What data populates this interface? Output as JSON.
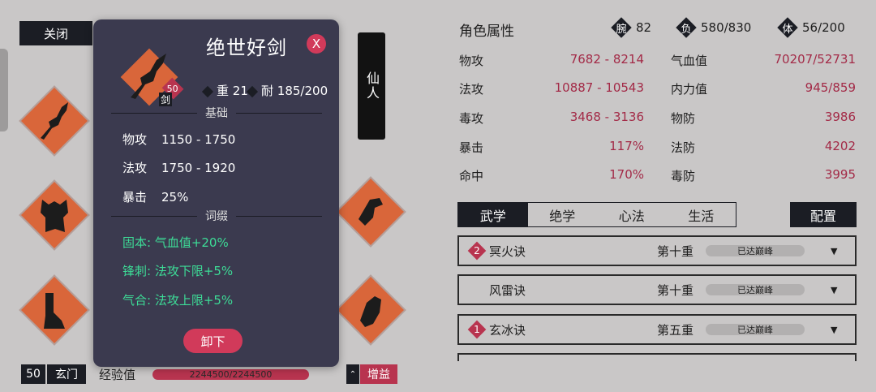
{
  "equipment": {
    "close_label": "关闭",
    "immortal_label": "仙人",
    "slots": [
      {
        "icon": "sword-icon"
      },
      {
        "icon": "armor-icon"
      },
      {
        "icon": "boots-icon"
      },
      {
        "icon": "bracer-icon"
      },
      {
        "icon": "amulet-icon"
      }
    ]
  },
  "bottom_bar": {
    "level": "50",
    "sect": "玄门",
    "exp_label": "经验值",
    "exp_value": "2244500/2244500",
    "exp_fraction": 1.0,
    "buff_label": "增益"
  },
  "popup": {
    "name": "绝世好剑",
    "close_label": "X",
    "level": "50",
    "type": "剑",
    "weight_label": "重",
    "weight": "21",
    "durability_label": "耐",
    "durability": "185/200",
    "base_header": "基础",
    "base_stats": [
      {
        "label": "物攻",
        "value": "1150 - 1750"
      },
      {
        "label": "法攻",
        "value": "1750 - 1920"
      },
      {
        "label": "暴击",
        "value": "25%"
      }
    ],
    "affix_header": "词缀",
    "affixes": [
      {
        "text": "固本: 气血值+20%"
      },
      {
        "text": "锋刺: 法攻下限+5%"
      },
      {
        "text": "气合: 法攻上限+5%"
      }
    ],
    "unequip_label": "卸下",
    "accent_color": "#d13a5a",
    "affix_color": "#3ddc97"
  },
  "attributes": {
    "title": "角色属性",
    "header_stats": [
      {
        "glyph": "腕",
        "value": "82"
      },
      {
        "glyph": "负",
        "value": "580/830"
      },
      {
        "glyph": "体",
        "value": "56/200"
      }
    ],
    "left": [
      {
        "label": "物攻",
        "value": "7682 - 8214"
      },
      {
        "label": "法攻",
        "value": "10887 - 10543"
      },
      {
        "label": "毒攻",
        "value": "3468 - 3136"
      },
      {
        "label": "暴击",
        "value": "117%"
      },
      {
        "label": "命中",
        "value": "170%"
      }
    ],
    "right": [
      {
        "label": "气血值",
        "value": "70207/52731"
      },
      {
        "label": "内力值",
        "value": "945/859"
      },
      {
        "label": "物防",
        "value": "3986"
      },
      {
        "label": "法防",
        "value": "4202"
      },
      {
        "label": "毒防",
        "value": "3995"
      }
    ],
    "value_color": "#a32a47"
  },
  "skills": {
    "tabs": [
      "武学",
      "绝学",
      "心法",
      "生活"
    ],
    "active_tab": 0,
    "config_label": "配置",
    "rows": [
      {
        "badge": "2",
        "name": "冥火诀",
        "stage": "第十重",
        "progress": "已达巅峰"
      },
      {
        "badge": "",
        "name": "风雷诀",
        "stage": "第十重",
        "progress": "已达巅峰"
      },
      {
        "badge": "1",
        "name": "玄冰诀",
        "stage": "第五重",
        "progress": "已达巅峰"
      }
    ]
  }
}
